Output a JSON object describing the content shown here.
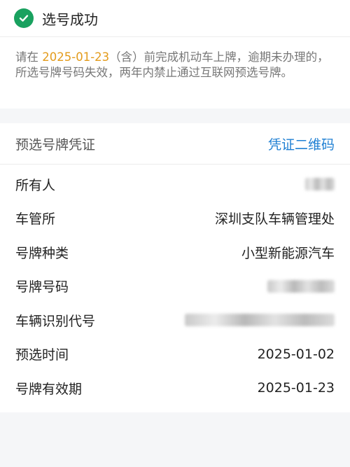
{
  "header": {
    "title": "选号成功"
  },
  "notice": {
    "prefix": "请在 ",
    "date": "2025-01-23",
    "suffix": "（含）前完成机动车上牌，逾期未办理的，所选号牌号码失效，两年内禁止通过互联网预选号牌。"
  },
  "voucher": {
    "title": "预选号牌凭证",
    "qr_link": "凭证二维码"
  },
  "details": {
    "owner_label": "所有人",
    "office_label": "车管所",
    "office_value": "深圳支队车辆管理处",
    "plate_type_label": "号牌种类",
    "plate_type_value": "小型新能源汽车",
    "plate_number_label": "号牌号码",
    "vin_label": "车辆识别代号",
    "preselect_time_label": "预选时间",
    "preselect_time_value": "2025-01-02",
    "valid_until_label": "号牌有效期",
    "valid_until_value": "2025-01-23"
  },
  "colors": {
    "success": "#19a15f",
    "accent_date": "#e39b1b",
    "link": "#1e7fd3"
  },
  "icons": {
    "success": "check-circle-icon"
  }
}
